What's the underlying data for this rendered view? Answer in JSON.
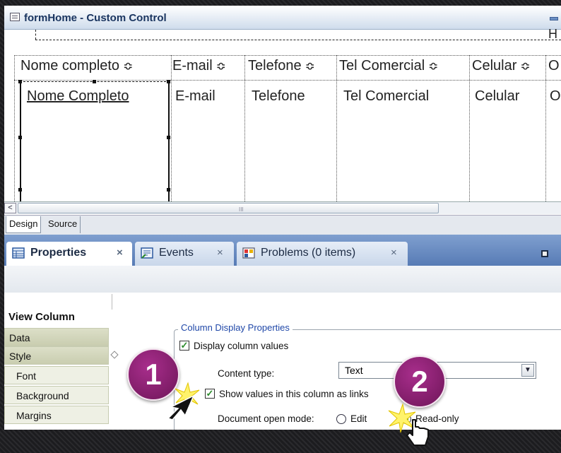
{
  "window": {
    "title": "formHome - Custom Control",
    "title_overflow": "H"
  },
  "view": {
    "columns": [
      "Nome  completo",
      "E-mail",
      "Telefone",
      "Tel Comercial",
      "Celular",
      "O"
    ],
    "row": [
      "Nome Completo",
      "E-mail",
      "Telefone",
      "Tel Comercial",
      "Celular",
      "O"
    ],
    "sort_glyph": "≎"
  },
  "scrollbar": {
    "grip": "III",
    "left_arrow": "<"
  },
  "editor_tabs": [
    "Design",
    "Source"
  ],
  "panel_tabs": [
    {
      "label": "Properties",
      "icon": "properties-icon"
    },
    {
      "label": "Events",
      "icon": "events-icon"
    },
    {
      "label": "Problems (0 items)",
      "icon": "problems-icon"
    }
  ],
  "close_glyph": "×",
  "sidebar": {
    "title": "View Column",
    "items": [
      "Data",
      "Style",
      "Font",
      "Background",
      "Margins"
    ]
  },
  "column_display": {
    "legend": "Column Display Properties",
    "display_values": "Display column values",
    "content_type_label": "Content type:",
    "content_type_value": "Text",
    "show_links": "Show values in this column as links",
    "open_mode_label": "Document open mode:",
    "open_mode_options": [
      "Edit",
      "Read-only"
    ],
    "selected_mode": "Read-only"
  },
  "check_glyph": "✓",
  "dropdown_glyph": "▼",
  "callouts": [
    "1",
    "2"
  ],
  "colors": {
    "accent": "#577bb5",
    "callout": "#8a1f72",
    "check": "#2a8a2a"
  }
}
